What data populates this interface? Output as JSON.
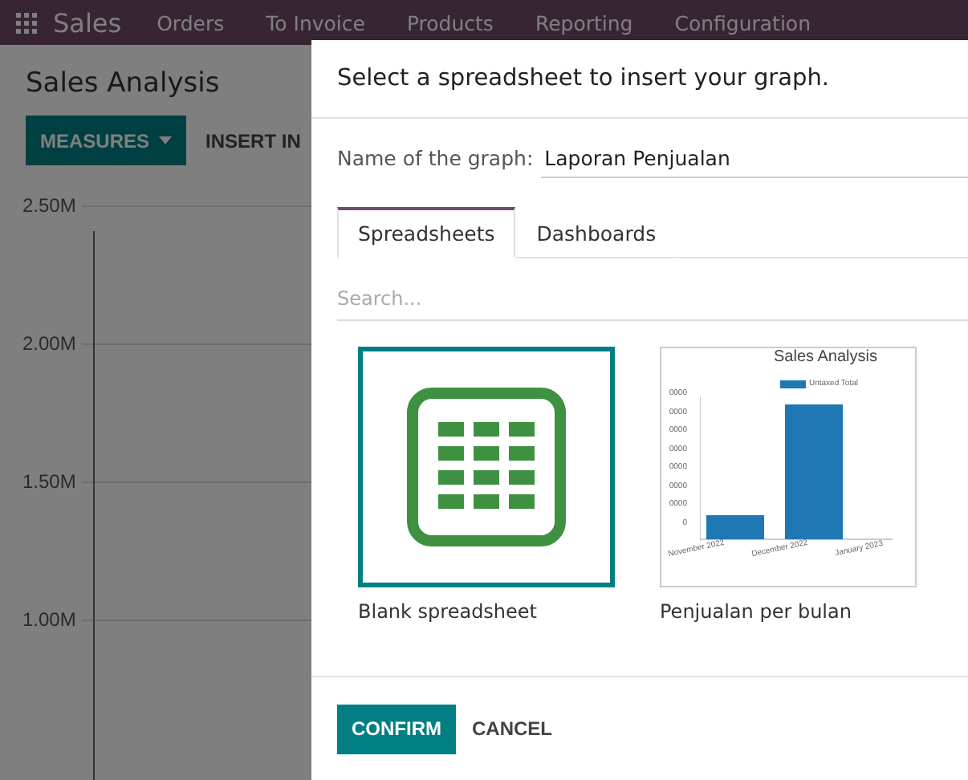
{
  "navbar": {
    "app": "Sales",
    "menu": [
      "Orders",
      "To Invoice",
      "Products",
      "Reporting",
      "Configuration"
    ]
  },
  "page": {
    "title": "Sales Analysis",
    "buttons": [
      {
        "label": "MEASURES",
        "kind": "primary"
      },
      {
        "label": "INSERT IN",
        "kind": "link"
      }
    ],
    "y_axis_labels": [
      "2.50M",
      "2.00M",
      "1.50M",
      "1.00M"
    ]
  },
  "dialog": {
    "title": "Select a spreadsheet to insert your graph.",
    "name_label": "Name of the graph:",
    "name_value": "Laporan Penjualan",
    "tabs": [
      {
        "label": "Spreadsheets",
        "selected": true
      },
      {
        "label": "Dashboards",
        "selected": false
      }
    ],
    "search": {
      "placeholder": "Search..."
    },
    "items": [
      {
        "kind": "blank",
        "caption": "Blank spreadsheet",
        "selected": true
      },
      {
        "kind": "chart",
        "caption": "Penjualan per bulan",
        "selected": false,
        "thumb_title": "Sales Analysis",
        "thumb_legend": "Untaxed Total",
        "thumb_y_labels": [
          "0000",
          "0000",
          "0000",
          "0000",
          "0000",
          "0000",
          "0000",
          "0"
        ],
        "thumb_x_labels": [
          "November 2022",
          "December 2022",
          "January 2023"
        ]
      }
    ],
    "buttons": [
      {
        "label": "CONFIRM",
        "kind": "primary"
      },
      {
        "label": "CANCEL",
        "kind": "link"
      }
    ]
  }
}
